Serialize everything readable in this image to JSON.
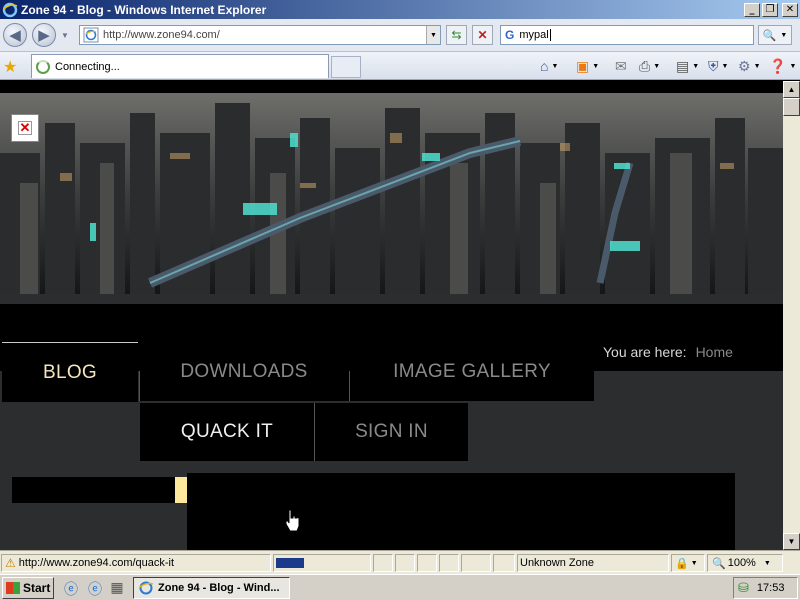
{
  "window": {
    "title": "Zone 94 - Blog - Windows Internet Explorer",
    "minimize": "_",
    "maximize": "❐",
    "close": "✕"
  },
  "address_bar": {
    "url": "http://www.zone94.com/",
    "search_value": "mypal",
    "search_engine_glyph": "G"
  },
  "tab": {
    "label": "Connecting..."
  },
  "page": {
    "nav": {
      "blog": "BLOG",
      "downloads": "DOWNLOADS",
      "image_gallery": "IMAGE GALLERY",
      "quack_it": "QUACK IT",
      "sign_in": "SIGN IN"
    },
    "breadcrumb": {
      "prefix": "You are here:",
      "current": "Home"
    },
    "colors": {
      "active_nav": "#f3e6c0",
      "inactive_nav": "#8a8a8a",
      "highlight": "#fde79c",
      "bar": "#2b2d2e"
    }
  },
  "status": {
    "link": "http://www.zone94.com/quack-it",
    "zone": "Unknown Zone",
    "zoom": "100%"
  },
  "taskbar": {
    "start": "Start",
    "task": "Zone 94 - Blog - Wind...",
    "clock": "17:53"
  },
  "icons": {
    "back": "back-arrow-icon",
    "forward": "forward-arrow-icon",
    "refresh": "refresh-icon",
    "stop": "stop-icon",
    "search": "magnifier-icon",
    "favorites": "star-icon",
    "home": "home-icon",
    "feeds": "rss-icon",
    "mail": "mail-icon",
    "print": "printer-icon",
    "page": "page-icon",
    "safety": "shield-icon",
    "tools": "gear-icon",
    "help": "help-icon"
  }
}
